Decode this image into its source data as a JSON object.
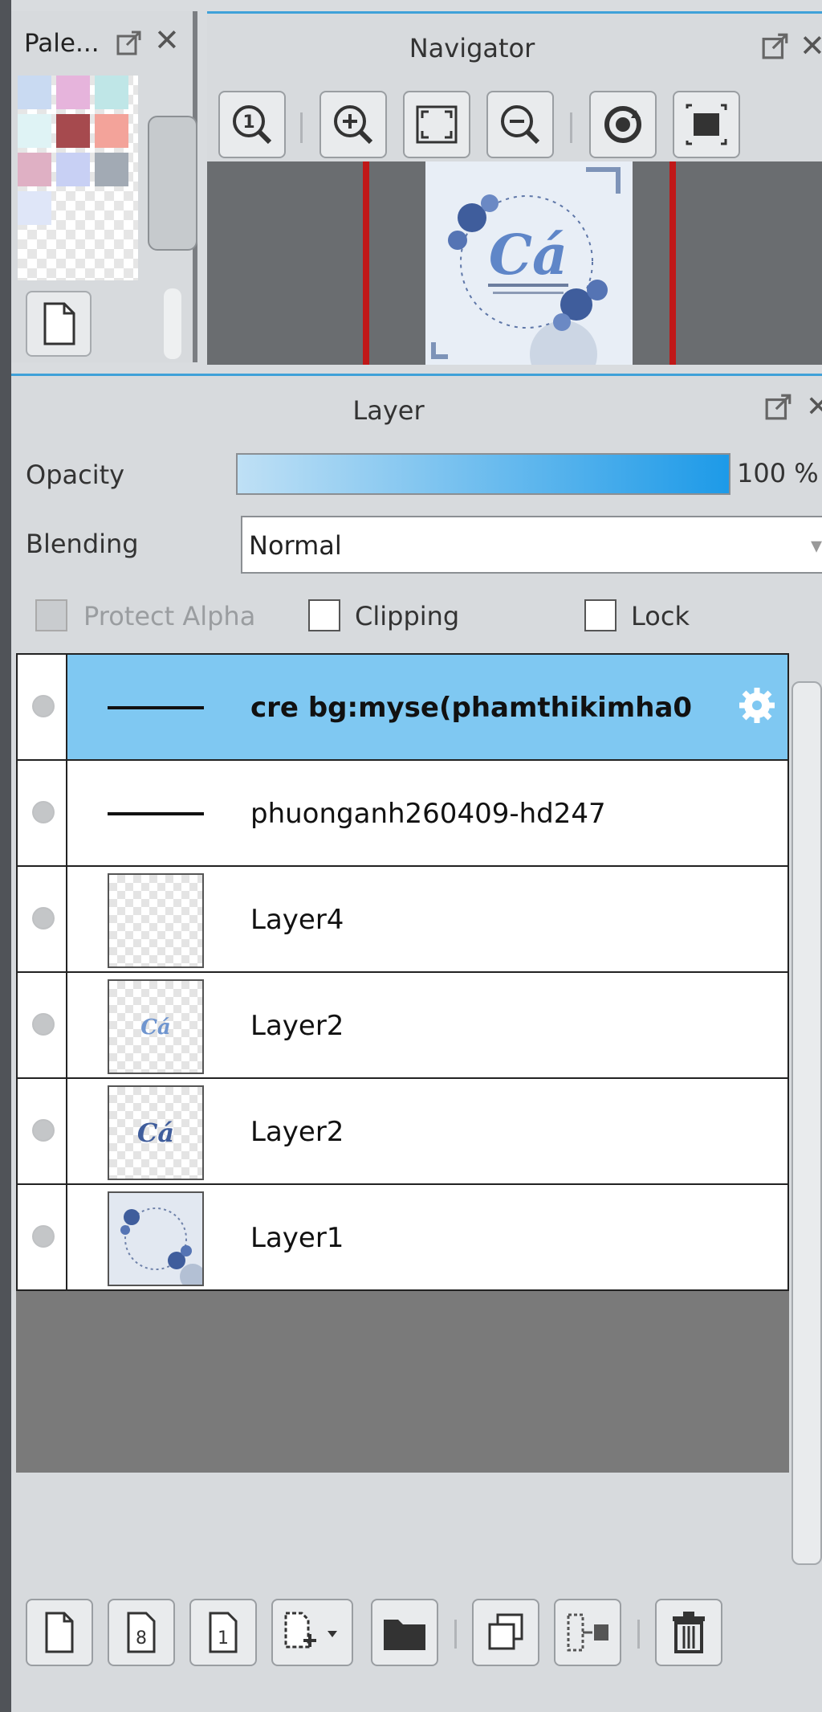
{
  "palette": {
    "title": "Pale...",
    "colors": [
      "#c9daf2",
      "#e6b4dc",
      "#bfe6e7",
      "#dff3f5",
      "#a64a4e",
      "#f3a39a",
      "#dfb0c4",
      "#c8d0f4",
      "#a2aab4",
      "#dfe6f8"
    ]
  },
  "navigator": {
    "title": "Navigator"
  },
  "layer": {
    "title": "Layer",
    "opacity_label": "Opacity",
    "opacity_value": "100 %",
    "opacity_level": 1.0,
    "blending_label": "Blending",
    "blending_value": "Normal",
    "protect_alpha_label": "Protect Alpha",
    "clipping_label": "Clipping",
    "lock_label": "Lock",
    "items": [
      {
        "name": "cre bg:myse(phamthikimha0",
        "type": "text",
        "selected": true
      },
      {
        "name": "phuonganh260409-hd247",
        "type": "text",
        "selected": false
      },
      {
        "name": "Layer4",
        "type": "raster",
        "selected": false
      },
      {
        "name": "Layer2",
        "type": "raster",
        "selected": false
      },
      {
        "name": "Layer2",
        "type": "raster",
        "selected": false
      },
      {
        "name": "Layer1",
        "type": "raster",
        "selected": false
      }
    ]
  },
  "colors": {
    "accent": "#3fa1d8",
    "selection": "#7fc8f2",
    "navigator_guide": "#c01818"
  }
}
